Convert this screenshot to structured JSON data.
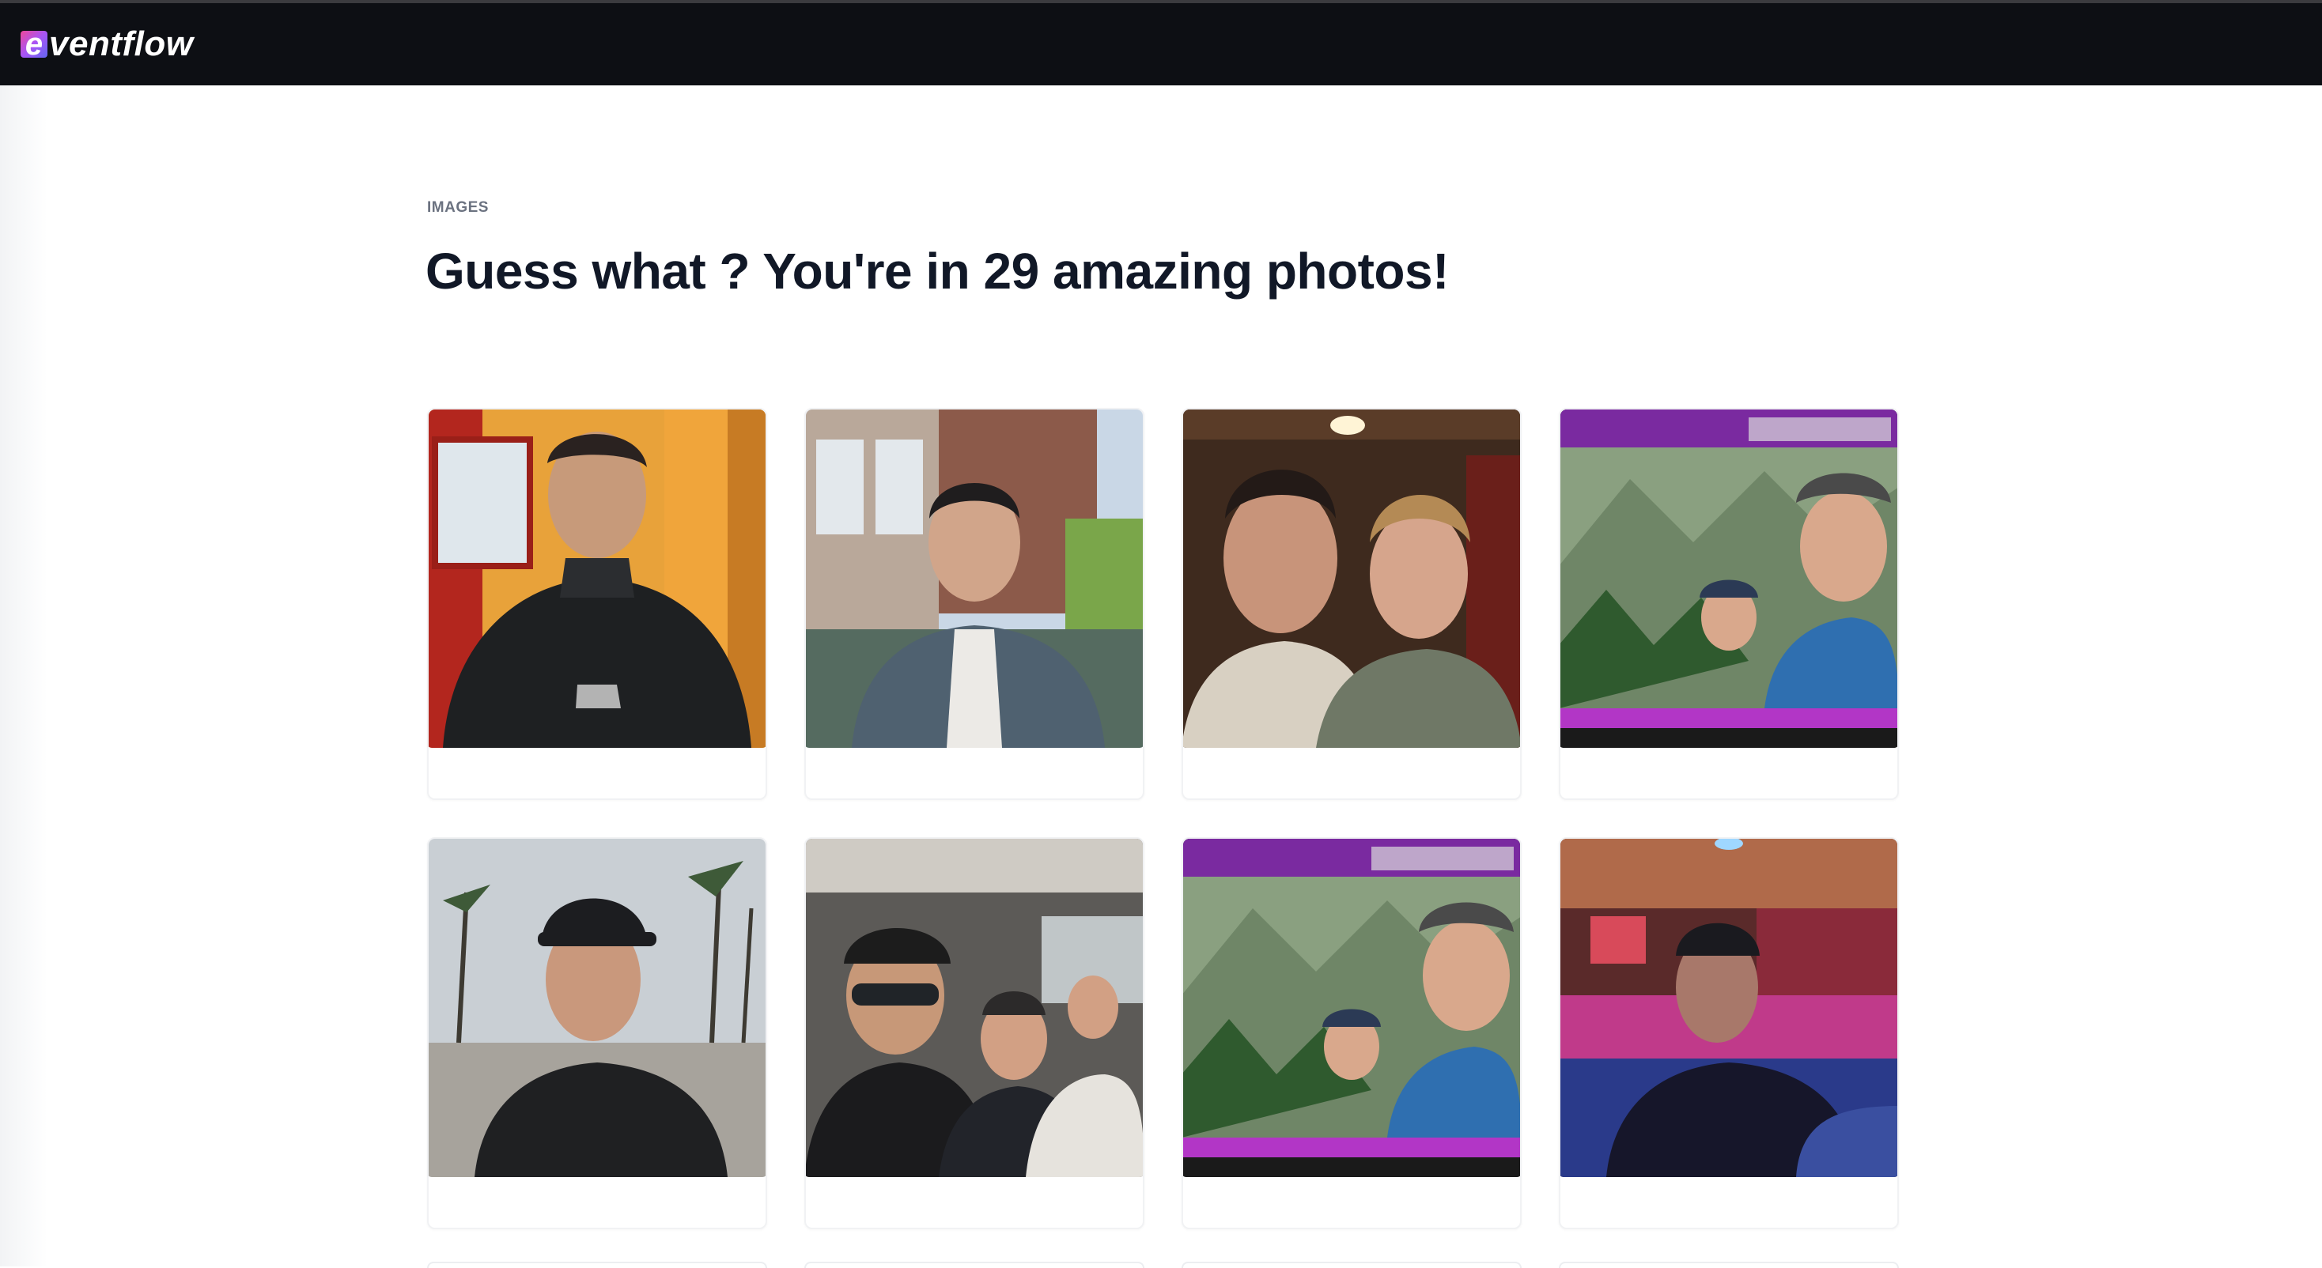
{
  "app": {
    "logo_mark": "e",
    "logo_text": "ventflow"
  },
  "section": {
    "label": "IMAGES",
    "title": "Guess what ? You're in 29 amazing photos!"
  },
  "photos": [
    {
      "caption": "",
      "scene": "cafe-selfie-black-hoodie"
    },
    {
      "caption": "",
      "scene": "street-portrait-denim-jacket"
    },
    {
      "caption": "",
      "scene": "restaurant-selfie-two-people"
    },
    {
      "caption": "",
      "scene": "screen-photo-mountain-selfie"
    },
    {
      "caption": "",
      "scene": "beach-boardwalk-portrait-cap"
    },
    {
      "caption": "",
      "scene": "car-selfie-group"
    },
    {
      "caption": "",
      "scene": "screen-photo-mountain-selfie"
    },
    {
      "caption": "",
      "scene": "bar-selfie-neon"
    }
  ],
  "colors": {
    "navbar": "#0d0f14",
    "title": "#111827",
    "label": "#6b7280",
    "accent_gradient": [
      "#ec4899",
      "#a855f7",
      "#6366f1"
    ]
  }
}
